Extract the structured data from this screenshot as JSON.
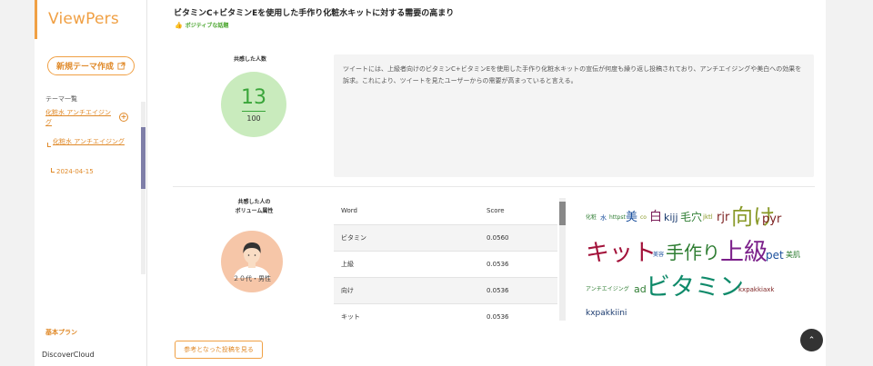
{
  "sidebar": {
    "logo": "ViewPers",
    "new_theme_label": "新規テーマ作成",
    "theme_list_label": "テーマ一覧",
    "theme_item": "化粧水 アンチエイジング",
    "theme_sub": "化粧水 アンチエイジング",
    "theme_date": "2024-04-15",
    "plan_label": "基本プラン",
    "brand": "DiscoverCloud"
  },
  "topic": {
    "title": "ビタミンC+ビタミンEを使用した手作り化粧水キットに対する需要の高まり",
    "sentiment": "ポジティブな話題"
  },
  "empathy": {
    "label": "共感した人数",
    "count": "13",
    "total": "100"
  },
  "summary": {
    "text": "ツイートには、上級者向けのビタミンC+ビタミンEを使用した手作り化粧水キットの宣伝が何度も繰り返し投稿されており、アンチエイジングや美白への効果を訴求。これにより、ツイートを見たユーザーからの需要が高まっていると言える。"
  },
  "attributes": {
    "label": "共感した人の\nボリューム属性",
    "demographic": "２０代・男性"
  },
  "word_table": {
    "col_word": "Word",
    "col_score": "Score",
    "rows": [
      {
        "word": "ビタミン",
        "score": "0.0560"
      },
      {
        "word": "上級",
        "score": "0.0536"
      },
      {
        "word": "向け",
        "score": "0.0536"
      },
      {
        "word": "キット",
        "score": "0.0536"
      }
    ]
  },
  "word_cloud": [
    {
      "text": "化粧",
      "color": "#2e7d32"
    },
    {
      "text": "水",
      "color": "#1a4f9c"
    },
    {
      "text": "httpst",
      "color": "#2e7d32"
    },
    {
      "text": "美",
      "color": "#1a4f9c"
    },
    {
      "text": "co",
      "color": "#8a9a2a"
    },
    {
      "text": "白",
      "color": "#7b1f5a"
    },
    {
      "text": "kijj",
      "color": "#1a3a6e"
    },
    {
      "text": "毛穴",
      "color": "#2e7d32"
    },
    {
      "text": "jktl",
      "color": "#8a9a2a"
    },
    {
      "text": "rjr",
      "color": "#7b1f1f"
    },
    {
      "text": "向け",
      "color": "#8a9a2a"
    },
    {
      "text": "pyr",
      "color": "#7b1f1f"
    },
    {
      "text": "キット",
      "color": "#a3123a"
    },
    {
      "text": "美容",
      "color": "#1a4f9c"
    },
    {
      "text": "手作り",
      "color": "#2e7d32"
    },
    {
      "text": "上級",
      "color": "#7b1f8a"
    },
    {
      "text": "pet",
      "color": "#1a4f9c"
    },
    {
      "text": "美肌",
      "color": "#2e7d32"
    },
    {
      "text": "アンチエイジング",
      "color": "#2e7d32"
    },
    {
      "text": "ad",
      "color": "#2e7d32"
    },
    {
      "text": "ビタミン",
      "color": "#0f8a6a"
    },
    {
      "text": "kxpakkiaxk",
      "color": "#7b1f1f"
    },
    {
      "text": "kxpakkiini",
      "color": "#1a3a6e"
    }
  ],
  "reference_button": "参考となった投稿を見る",
  "colors": {
    "accent": "#f0a044",
    "positive": "#4aa52e",
    "empathy_circle": "#c9ebbd",
    "avatar_circle": "#f6c6a8"
  }
}
